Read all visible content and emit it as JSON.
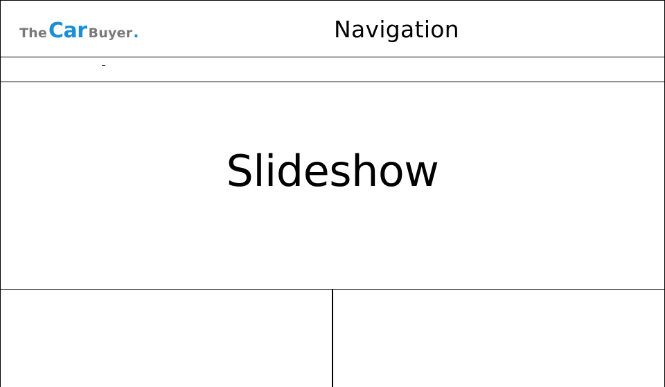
{
  "header": {
    "logo": {
      "the": "The",
      "car": "Car",
      "buyer": "Buyer",
      "dot": "."
    },
    "navigation_label": "Navigation"
  },
  "secondary_bar": {
    "mark": "-"
  },
  "slideshow": {
    "label": "Slideshow"
  },
  "colors": {
    "brand_blue": "#1b8fd6",
    "brand_gray": "#7a7a7a",
    "border": "#000000"
  }
}
